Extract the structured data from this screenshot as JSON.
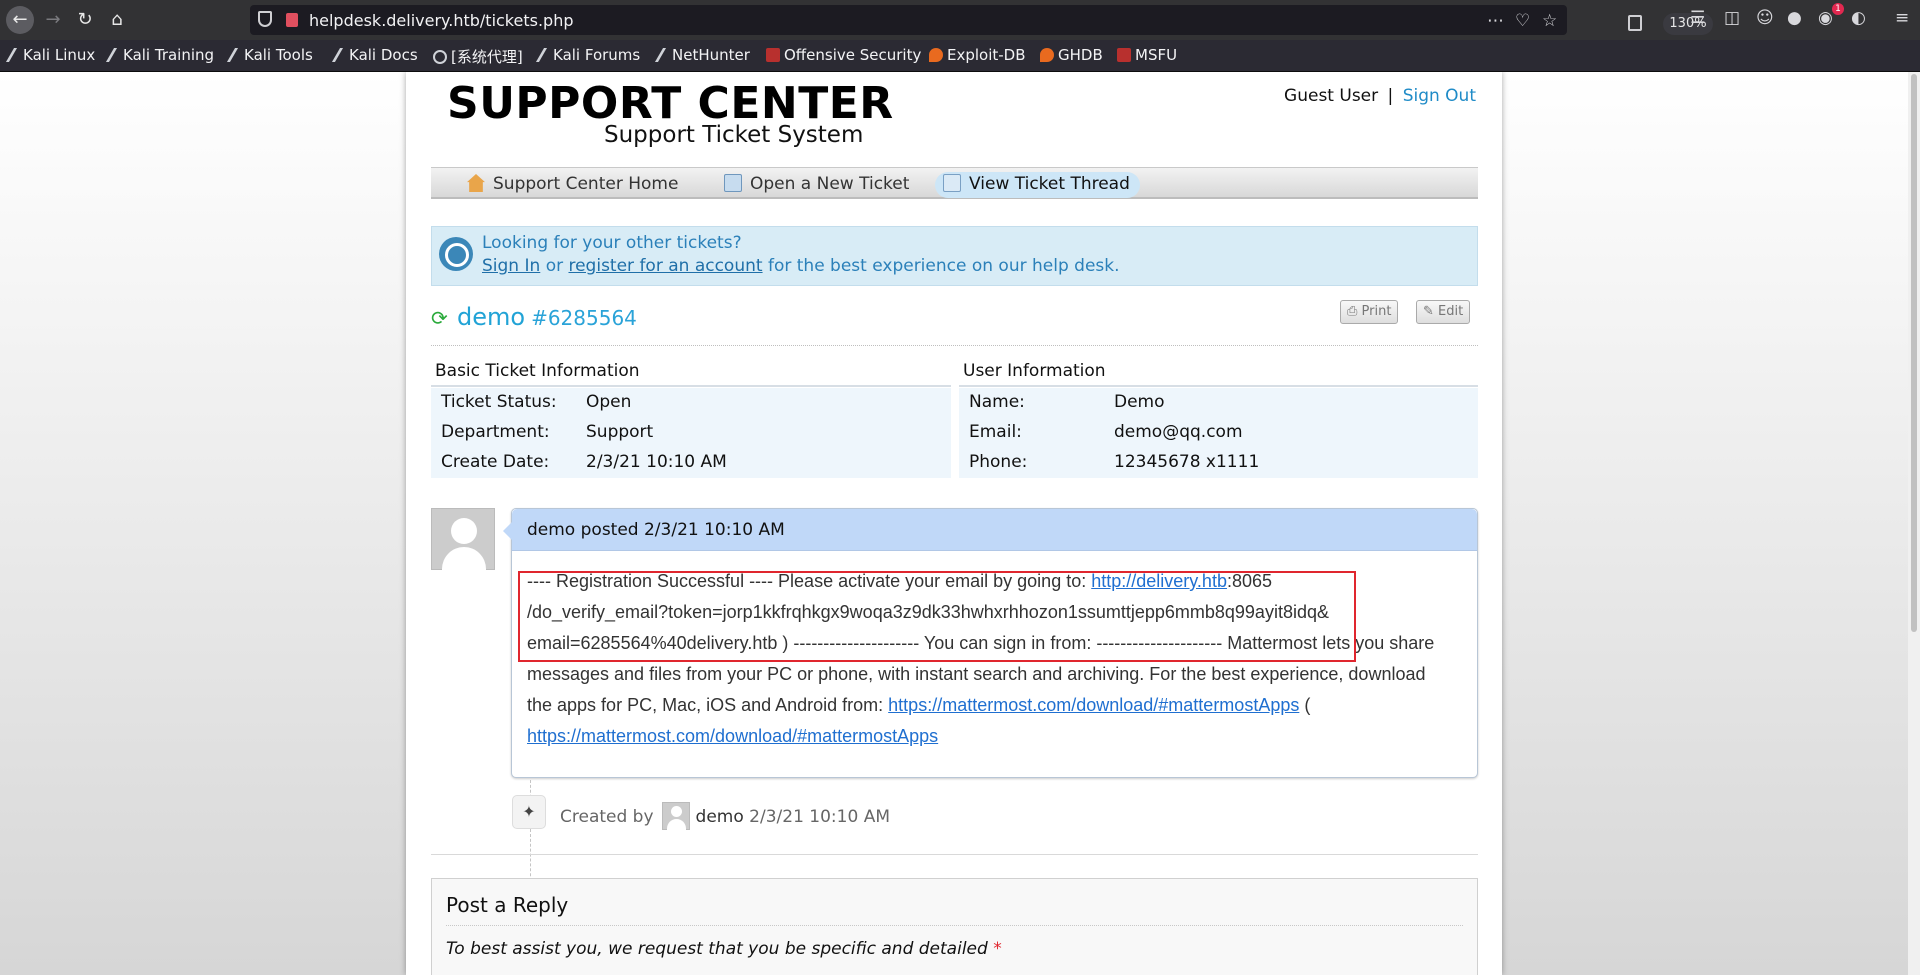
{
  "browser": {
    "url": "helpdesk.delivery.htb/tickets.php",
    "zoom": "130%",
    "extension_badge": "1",
    "icons": [
      "back-icon",
      "forward-icon",
      "reload-icon",
      "home-icon",
      "shield-icon",
      "insecure-lock-icon",
      "reader-view-icon",
      "more-icon",
      "pocket-icon",
      "bookmark-star-icon",
      "library-icon",
      "sidebar-icon",
      "account-icon",
      "extension-icon",
      "menu-icon"
    ]
  },
  "bookmarks": [
    {
      "label": "Kali Linux",
      "icon": "kali"
    },
    {
      "label": "Kali Training",
      "icon": "kali"
    },
    {
      "label": "Kali Tools",
      "icon": "kali"
    },
    {
      "label": "Kali Docs",
      "icon": "kali"
    },
    {
      "label": "[系统代理]",
      "icon": "globe"
    },
    {
      "label": "Kali Forums",
      "icon": "kali"
    },
    {
      "label": "NetHunter",
      "icon": "kali"
    },
    {
      "label": "Offensive Security",
      "icon": "offsec"
    },
    {
      "label": "Exploit-DB",
      "icon": "edb"
    },
    {
      "label": "GHDB",
      "icon": "edb"
    },
    {
      "label": "MSFU",
      "icon": "offsec"
    }
  ],
  "header": {
    "title": "SUPPORT CENTER",
    "subtitle": "Support Ticket System",
    "user": "Guest User",
    "separator": "|",
    "sign_out": "Sign Out"
  },
  "nav": {
    "home": "Support Center Home",
    "new_ticket": "Open a New Ticket",
    "view_thread": "View Ticket Thread"
  },
  "notice": {
    "question": "Looking for your other tickets?",
    "sign_in": "Sign In",
    "or": "or",
    "register": "register for an account",
    "rest": "for the best experience on our help desk."
  },
  "ticket": {
    "subject": "demo",
    "number": "#6285564",
    "print": "Print",
    "edit": "Edit"
  },
  "basic_info": {
    "heading": "Basic Ticket Information",
    "rows": [
      {
        "label": "Ticket Status:",
        "value": "Open"
      },
      {
        "label": "Department:",
        "value": "Support"
      },
      {
        "label": "Create Date:",
        "value": "2/3/21 10:10 AM"
      }
    ]
  },
  "user_info": {
    "heading": "User Information",
    "rows": [
      {
        "label": "Name:",
        "value": "Demo"
      },
      {
        "label": "Email:",
        "value": "demo@qq.com"
      },
      {
        "label": "Phone:",
        "value": "12345678 x1111"
      }
    ]
  },
  "message": {
    "author": "demo",
    "posted": "posted 2/3/21 10:10 AM",
    "line1_text": "---- Registration Successful ---- Please activate your email by going to: ",
    "line1_link": "http://delivery.htb",
    "line1_after": ":8065",
    "line2": "/do_verify_email?token=jorp1kkfrqhkgx9woqa3z9dk33hwhxrhhozon1ssumttjepp6mmb8q99ayit8idq&",
    "line3": "email=6285564%40delivery.htb ) --------------------- You can sign in from: --------------------- Mattermost lets you share",
    "line4": "messages and files from your PC or phone, with instant search and archiving. For the best experience, download",
    "line5_text": "the apps for PC, Mac, iOS and Android from: ",
    "line5_link": "https://mattermost.com/download/#mattermostApps",
    "line5_after": " (",
    "line6_link": "https://mattermost.com/download/#mattermostApps"
  },
  "event": {
    "created_by": "Created by",
    "author": "demo",
    "time": "2/3/21 10:10 AM"
  },
  "reply": {
    "title": "Post a Reply",
    "hint": "To best assist you, we request that you be specific and detailed",
    "required": "*"
  }
}
